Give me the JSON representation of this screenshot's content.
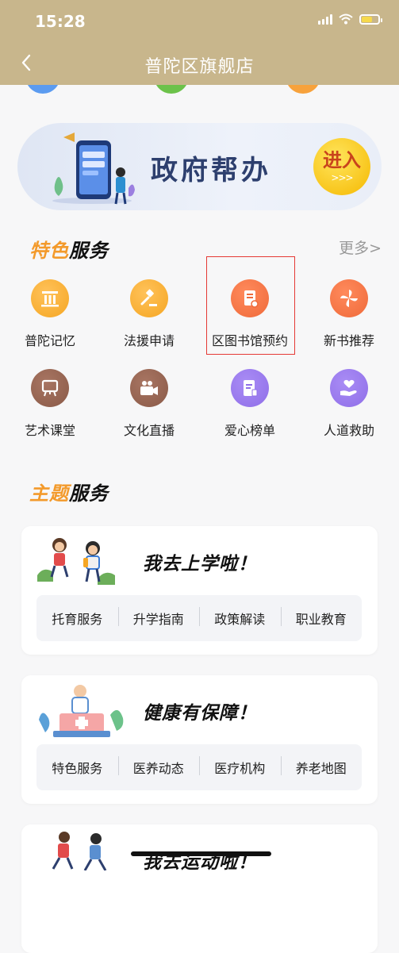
{
  "status": {
    "time": "15:28"
  },
  "header": {
    "title": "普陀区旗舰店"
  },
  "banner": {
    "text": "政府帮办",
    "enter": "进入",
    "arrows": ">>>"
  },
  "featured": {
    "title_accent": "特色",
    "title_main": "服务",
    "more": "更多>",
    "items": [
      {
        "label": "普陀记忆",
        "icon": "building-icon",
        "color": "#f5a623"
      },
      {
        "label": "法援申请",
        "icon": "gavel-icon",
        "color": "#f5a623"
      },
      {
        "label": "区图书馆预约",
        "icon": "book-icon",
        "color": "#ef6a3a"
      },
      {
        "label": "新书推荐",
        "icon": "pinwheel-icon",
        "color": "#ef6a3a"
      },
      {
        "label": "艺术课堂",
        "icon": "easel-icon",
        "color": "#8a5a48"
      },
      {
        "label": "文化直播",
        "icon": "video-camera-icon",
        "color": "#8a5a48"
      },
      {
        "label": "爱心榜单",
        "icon": "document-list-icon",
        "color": "#8f6ee8"
      },
      {
        "label": "人道救助",
        "icon": "heart-hand-icon",
        "color": "#8f6ee8"
      }
    ]
  },
  "theme": {
    "title_accent": "主题",
    "title_main": "服务",
    "cards": [
      {
        "title": "我去上学啦！",
        "items": [
          "托育服务",
          "升学指南",
          "政策解读",
          "职业教育"
        ]
      },
      {
        "title": "健康有保障！",
        "items": [
          "特色服务",
          "医养动态",
          "医疗机构",
          "养老地图"
        ]
      },
      {
        "title": "我去运动啦！"
      }
    ]
  }
}
